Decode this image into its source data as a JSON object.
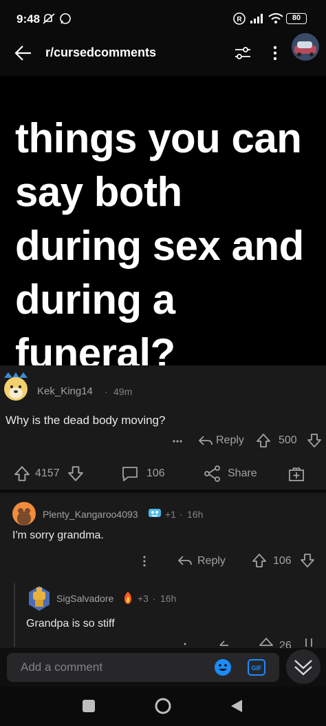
{
  "status_bar": {
    "time": "9:48",
    "battery": "80",
    "icons": [
      "mute-icon",
      "whatsapp-icon",
      "registered-icon",
      "signal-icon",
      "wifi-icon",
      "battery-icon"
    ]
  },
  "header": {
    "title": "r/cursedcomments",
    "icons": [
      "back-arrow-icon",
      "filter-icon",
      "more-icon",
      "avatar"
    ]
  },
  "post": {
    "image_text": "things you can say both during sex and during a funeral?",
    "upvotes": "4157",
    "comments": "106",
    "share_label": "Share"
  },
  "top_comment": {
    "username": "Kek_King14",
    "time": "49m",
    "text": "Why is the dead body moving?",
    "reply_label": "Reply",
    "votes": "500"
  },
  "comment_1": {
    "username": "Plenty_Kangaroo4093",
    "award_count": "+1",
    "time": "16h",
    "text": "I'm sorry grandma.",
    "reply_label": "Reply",
    "votes": "106"
  },
  "comment_2": {
    "username": "SigSalvadore",
    "award_count": "+3",
    "time": "16h",
    "text": "Grandpa is so stiff",
    "votes": "26"
  },
  "comment_bar": {
    "placeholder": "Add a comment"
  },
  "colors": {
    "background": "#1a1a1b",
    "accent_blue": "#1a8cff",
    "text_muted": "#818384"
  }
}
